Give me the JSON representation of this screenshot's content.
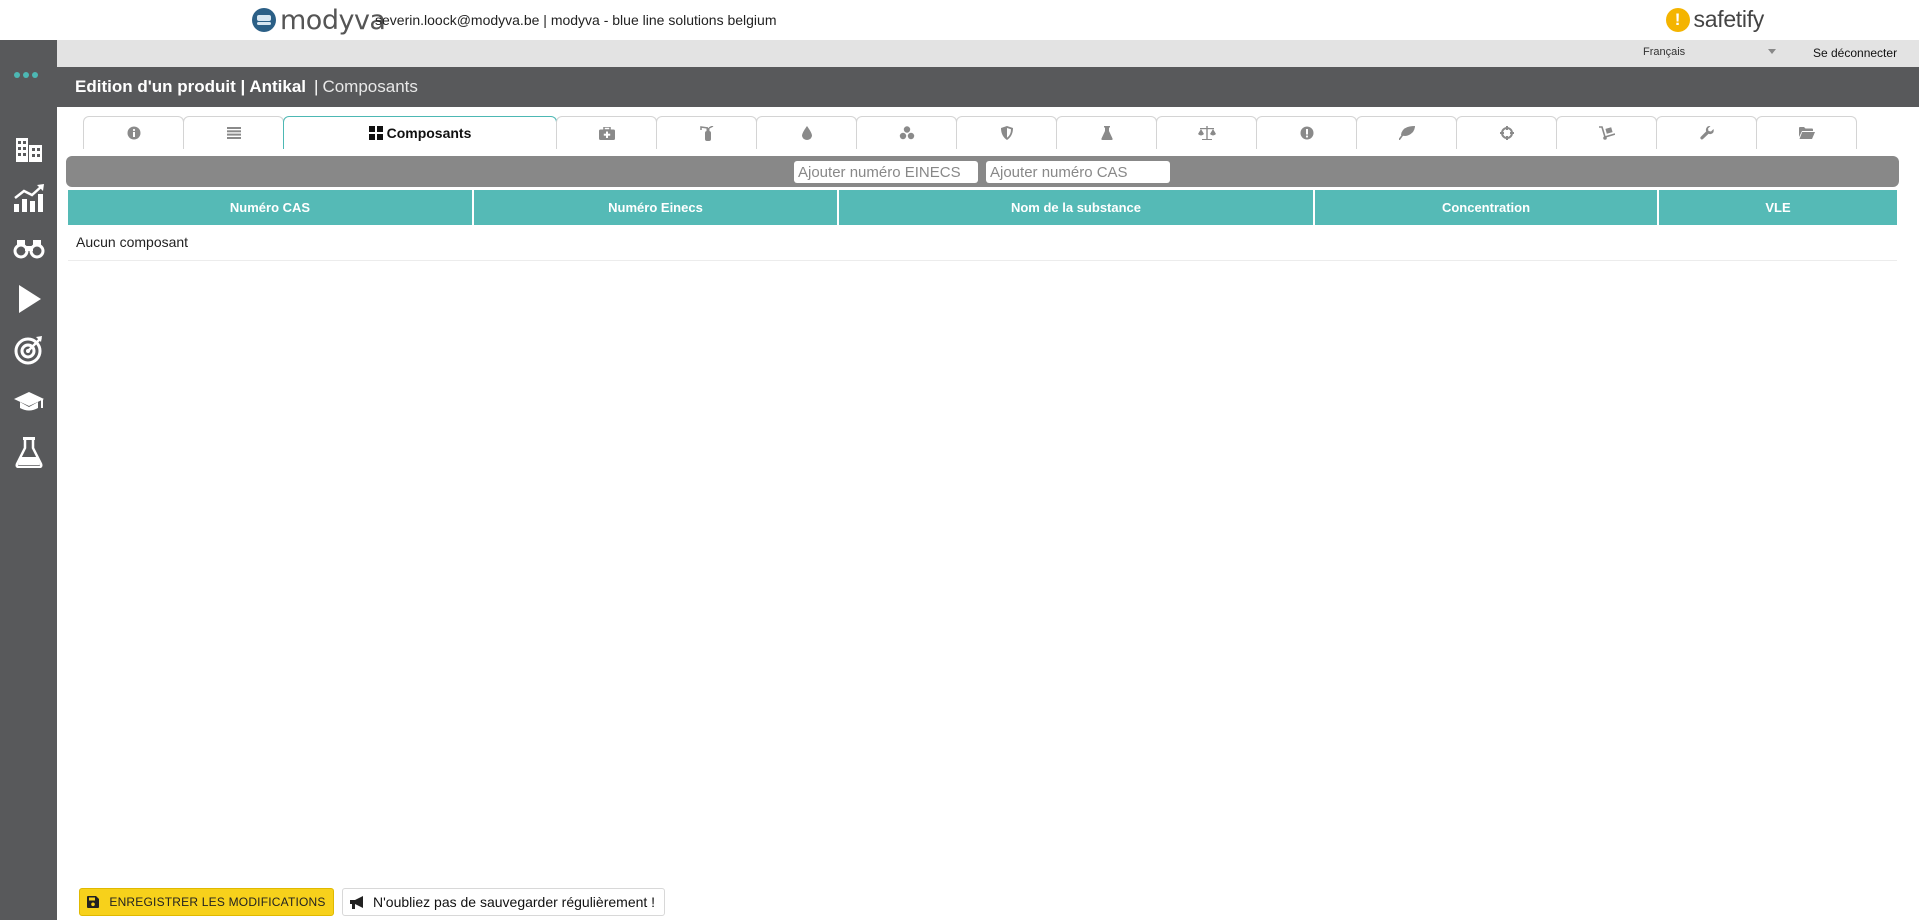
{
  "header": {
    "brand": "modyva",
    "user_line": "severin.loock@modyva.be | modyva - blue line solutions belgium",
    "partner_brand": "safetify",
    "partner_icon_char": "!"
  },
  "subbar": {
    "language": "Français",
    "logout": "Se déconnecter"
  },
  "titlebar": {
    "title": "Edition d'un produit | Antikal",
    "separator": "|",
    "section": "Composants"
  },
  "sidebar": {
    "items": [
      {
        "icon": "buildings-icon"
      },
      {
        "icon": "chart-growth-icon"
      },
      {
        "icon": "binoculars-icon"
      },
      {
        "icon": "play-icon"
      },
      {
        "icon": "target-icon"
      },
      {
        "icon": "graduation-cap-icon"
      },
      {
        "icon": "flask-icon"
      }
    ]
  },
  "tabs": [
    {
      "icon": "info-icon"
    },
    {
      "icon": "list-icon"
    },
    {
      "icon": "grid-icon",
      "label": "Composants",
      "active": true
    },
    {
      "icon": "first-aid-icon"
    },
    {
      "icon": "extinguisher-icon"
    },
    {
      "icon": "drop-icon"
    },
    {
      "icon": "molecule-icon"
    },
    {
      "icon": "shield-icon"
    },
    {
      "icon": "flask-icon"
    },
    {
      "icon": "balance-icon"
    },
    {
      "icon": "exclamation-icon"
    },
    {
      "icon": "leaf-icon"
    },
    {
      "icon": "crosshair-icon"
    },
    {
      "icon": "dolly-icon"
    },
    {
      "icon": "wrench-icon"
    },
    {
      "icon": "folder-icon"
    }
  ],
  "addbar": {
    "einecs_placeholder": "Ajouter numéro EINECS",
    "cas_placeholder": "Ajouter numéro CAS"
  },
  "table": {
    "columns": [
      "Numéro CAS",
      "Numéro Einecs",
      "Nom de la substance",
      "Concentration",
      "VLE"
    ],
    "empty_message": "Aucun composant"
  },
  "footer": {
    "save_label": "ENREGISTRER LES MODIFICATIONS",
    "reminder": "N'oubliez pas de sauvegarder régulièrement !"
  },
  "colors": {
    "accent": "#4db8b4",
    "sidebar": "#58595b",
    "save_button": "#f7d11b",
    "brand_blue": "#2b5f86",
    "safetify_orange": "#f4b400"
  }
}
